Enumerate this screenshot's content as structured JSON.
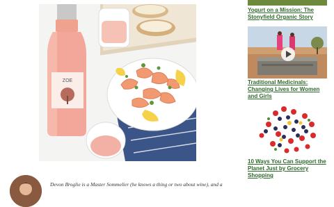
{
  "hero": {
    "label_text": "ZOE"
  },
  "sidebar": {
    "items": [
      {
        "title": "Yogurt on a Mission: The Stonyfield Organic Story"
      },
      {
        "title": "Traditional Medicinals: Changing Lives for Women and Girls"
      },
      {
        "title": "10 Ways You Can Support the Planet Just by Grocery Shopping"
      }
    ]
  },
  "author": {
    "bio": "Devon Broglie is a Master Sommelier (he knows a thing or two about wine), and a"
  },
  "colors": {
    "link_green": "#2e6b2a",
    "rose": "#f2a79a"
  },
  "icons": {
    "play": "play-icon"
  }
}
